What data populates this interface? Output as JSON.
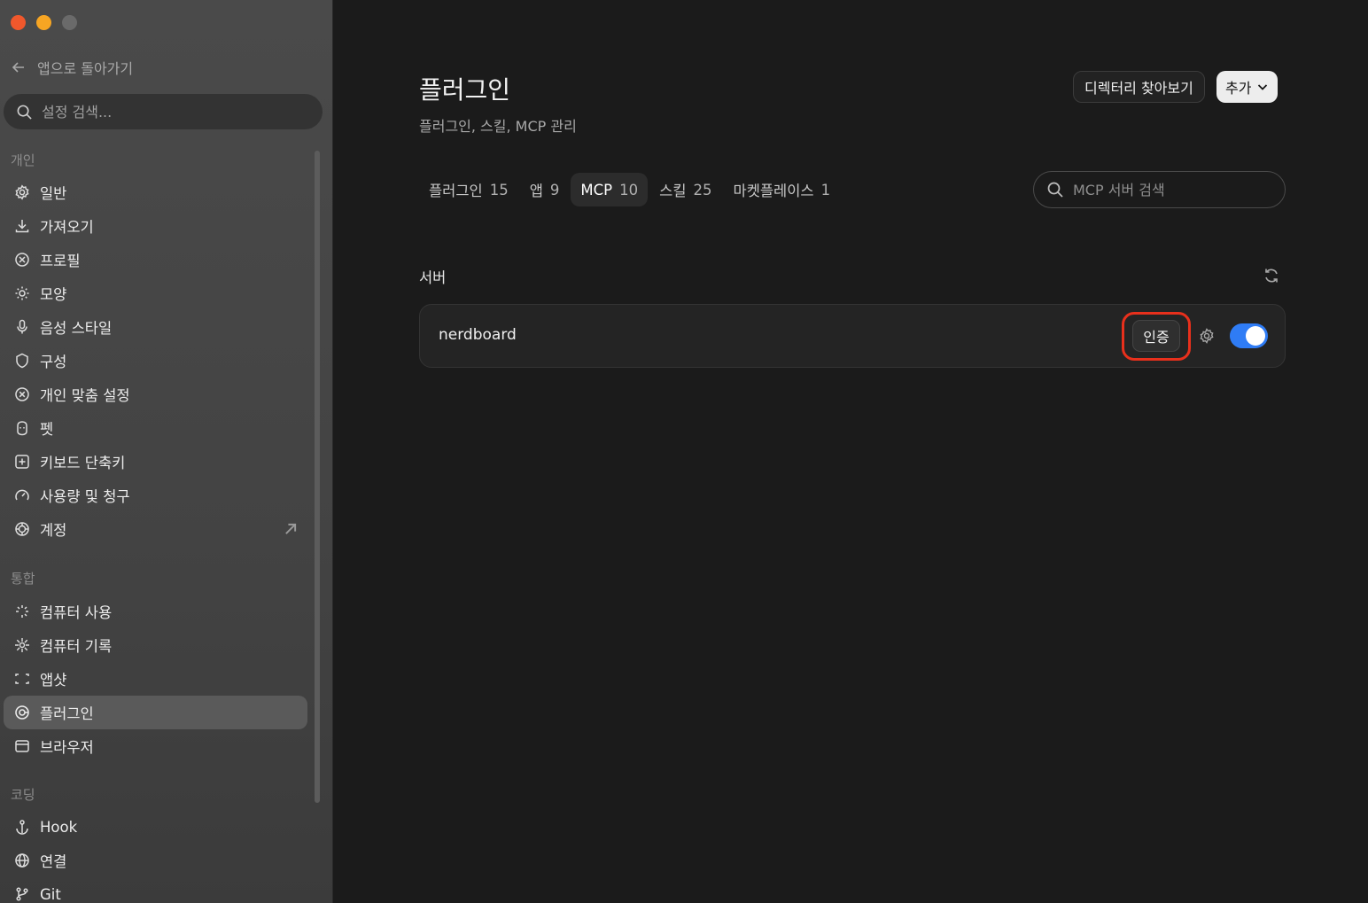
{
  "sidebar": {
    "back_label": "앱으로 돌아가기",
    "search_placeholder": "설정 검색...",
    "section_personal": "개인",
    "personal_items": [
      {
        "label": "일반",
        "icon": "gear-icon"
      },
      {
        "label": "가져오기",
        "icon": "download-icon"
      },
      {
        "label": "프로필",
        "icon": "profile-icon"
      },
      {
        "label": "모양",
        "icon": "sun-icon"
      },
      {
        "label": "음성 스타일",
        "icon": "microphone-icon"
      },
      {
        "label": "구성",
        "icon": "shield-icon"
      },
      {
        "label": "개인 맞춤 설정",
        "icon": "personalize-icon"
      },
      {
        "label": "펫",
        "icon": "pet-icon"
      },
      {
        "label": "키보드 단축키",
        "icon": "keyboard-icon"
      },
      {
        "label": "사용량 및 청구",
        "icon": "gauge-icon"
      },
      {
        "label": "계정",
        "icon": "account-icon"
      }
    ],
    "section_integration": "통합",
    "integration_items": [
      {
        "label": "컴퓨터 사용",
        "icon": "sparkle-icon"
      },
      {
        "label": "컴퓨터 기록",
        "icon": "burst-icon"
      },
      {
        "label": "앱샷",
        "icon": "screenshot-icon"
      },
      {
        "label": "플러그인",
        "icon": "plugin-icon"
      },
      {
        "label": "브라우저",
        "icon": "browser-icon"
      }
    ],
    "section_coding": "코딩",
    "coding_items": [
      {
        "label": "Hook",
        "icon": "anchor-icon"
      },
      {
        "label": "연결",
        "icon": "globe-icon"
      },
      {
        "label": "Git",
        "icon": "git-branch-icon"
      }
    ],
    "active_item": "플러그인"
  },
  "main": {
    "title": "플러그인",
    "subtitle": "플러그인, 스킬, MCP 관리",
    "directory_button": "디렉터리 찾아보기",
    "add_button": "추가",
    "tabs": [
      {
        "label": "플러그인",
        "count": "15"
      },
      {
        "label": "앱",
        "count": "9"
      },
      {
        "label": "MCP",
        "count": "10"
      },
      {
        "label": "스킬",
        "count": "25"
      },
      {
        "label": "마켓플레이스",
        "count": "1"
      }
    ],
    "active_tab": "MCP",
    "search_placeholder": "MCP 서버 검색",
    "servers_heading": "서버",
    "servers": [
      {
        "name": "nerdboard",
        "auth_label": "인증",
        "enabled": true
      }
    ]
  },
  "colors": {
    "toggle_on": "#2f7cf5",
    "highlight_ring": "#e8301c",
    "window_close": "#f0582c",
    "window_minimize": "#f7a523"
  }
}
